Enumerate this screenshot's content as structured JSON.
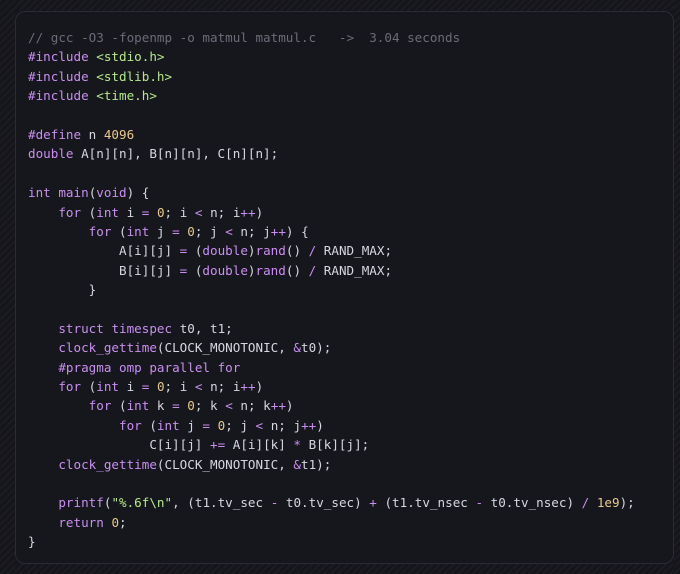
{
  "colors": {
    "background": "#15151b",
    "panel": "#16161d",
    "text": "#d7d7e0",
    "comment": "#6c6c78",
    "keyword": "#c98ff0",
    "string": "#b6e88a",
    "number": "#e8c98a"
  },
  "code": {
    "language": "c",
    "lines": [
      [
        {
          "t": "comment",
          "v": "// gcc -O3 -fopenmp -o matmul matmul.c   ->  3.04 seconds"
        }
      ],
      [
        {
          "t": "keyword",
          "v": "#include"
        },
        {
          "t": "plain",
          "v": " "
        },
        {
          "t": "string",
          "v": "<stdio.h>"
        }
      ],
      [
        {
          "t": "keyword",
          "v": "#include"
        },
        {
          "t": "plain",
          "v": " "
        },
        {
          "t": "string",
          "v": "<stdlib.h>"
        }
      ],
      [
        {
          "t": "keyword",
          "v": "#include"
        },
        {
          "t": "plain",
          "v": " "
        },
        {
          "t": "string",
          "v": "<time.h>"
        }
      ],
      [],
      [
        {
          "t": "keyword",
          "v": "#define"
        },
        {
          "t": "plain",
          "v": " n "
        },
        {
          "t": "number",
          "v": "4096"
        }
      ],
      [
        {
          "t": "keyword",
          "v": "double"
        },
        {
          "t": "plain",
          "v": " A[n][n], B[n][n], C[n][n];"
        }
      ],
      [],
      [
        {
          "t": "keyword",
          "v": "int"
        },
        {
          "t": "plain",
          "v": " "
        },
        {
          "t": "function",
          "v": "main"
        },
        {
          "t": "plain",
          "v": "("
        },
        {
          "t": "keyword",
          "v": "void"
        },
        {
          "t": "plain",
          "v": ") {"
        }
      ],
      [
        {
          "t": "plain",
          "v": "    "
        },
        {
          "t": "keyword",
          "v": "for"
        },
        {
          "t": "plain",
          "v": " ("
        },
        {
          "t": "keyword",
          "v": "int"
        },
        {
          "t": "plain",
          "v": " i "
        },
        {
          "t": "op",
          "v": "="
        },
        {
          "t": "plain",
          "v": " "
        },
        {
          "t": "number",
          "v": "0"
        },
        {
          "t": "plain",
          "v": "; i "
        },
        {
          "t": "op",
          "v": "<"
        },
        {
          "t": "plain",
          "v": " n; i"
        },
        {
          "t": "op",
          "v": "++"
        },
        {
          "t": "plain",
          "v": ")"
        }
      ],
      [
        {
          "t": "plain",
          "v": "        "
        },
        {
          "t": "keyword",
          "v": "for"
        },
        {
          "t": "plain",
          "v": " ("
        },
        {
          "t": "keyword",
          "v": "int"
        },
        {
          "t": "plain",
          "v": " j "
        },
        {
          "t": "op",
          "v": "="
        },
        {
          "t": "plain",
          "v": " "
        },
        {
          "t": "number",
          "v": "0"
        },
        {
          "t": "plain",
          "v": "; j "
        },
        {
          "t": "op",
          "v": "<"
        },
        {
          "t": "plain",
          "v": " n; j"
        },
        {
          "t": "op",
          "v": "++"
        },
        {
          "t": "plain",
          "v": ") {"
        }
      ],
      [
        {
          "t": "plain",
          "v": "            A[i][j] "
        },
        {
          "t": "op",
          "v": "="
        },
        {
          "t": "plain",
          "v": " ("
        },
        {
          "t": "keyword",
          "v": "double"
        },
        {
          "t": "plain",
          "v": ")"
        },
        {
          "t": "function",
          "v": "rand"
        },
        {
          "t": "plain",
          "v": "() "
        },
        {
          "t": "op",
          "v": "/"
        },
        {
          "t": "plain",
          "v": " RAND_MAX;"
        }
      ],
      [
        {
          "t": "plain",
          "v": "            B[i][j] "
        },
        {
          "t": "op",
          "v": "="
        },
        {
          "t": "plain",
          "v": " ("
        },
        {
          "t": "keyword",
          "v": "double"
        },
        {
          "t": "plain",
          "v": ")"
        },
        {
          "t": "function",
          "v": "rand"
        },
        {
          "t": "plain",
          "v": "() "
        },
        {
          "t": "op",
          "v": "/"
        },
        {
          "t": "plain",
          "v": " RAND_MAX;"
        }
      ],
      [
        {
          "t": "plain",
          "v": "        }"
        }
      ],
      [],
      [
        {
          "t": "plain",
          "v": "    "
        },
        {
          "t": "keyword",
          "v": "struct"
        },
        {
          "t": "plain",
          "v": " "
        },
        {
          "t": "keyword",
          "v": "timespec"
        },
        {
          "t": "plain",
          "v": " t0, t1;"
        }
      ],
      [
        {
          "t": "plain",
          "v": "    "
        },
        {
          "t": "function",
          "v": "clock_gettime"
        },
        {
          "t": "plain",
          "v": "(CLOCK_MONOTONIC, "
        },
        {
          "t": "op",
          "v": "&"
        },
        {
          "t": "plain",
          "v": "t0);"
        }
      ],
      [
        {
          "t": "plain",
          "v": "    "
        },
        {
          "t": "keyword",
          "v": "#pragma omp parallel for"
        }
      ],
      [
        {
          "t": "plain",
          "v": "    "
        },
        {
          "t": "keyword",
          "v": "for"
        },
        {
          "t": "plain",
          "v": " ("
        },
        {
          "t": "keyword",
          "v": "int"
        },
        {
          "t": "plain",
          "v": " i "
        },
        {
          "t": "op",
          "v": "="
        },
        {
          "t": "plain",
          "v": " "
        },
        {
          "t": "number",
          "v": "0"
        },
        {
          "t": "plain",
          "v": "; i "
        },
        {
          "t": "op",
          "v": "<"
        },
        {
          "t": "plain",
          "v": " n; i"
        },
        {
          "t": "op",
          "v": "++"
        },
        {
          "t": "plain",
          "v": ")"
        }
      ],
      [
        {
          "t": "plain",
          "v": "        "
        },
        {
          "t": "keyword",
          "v": "for"
        },
        {
          "t": "plain",
          "v": " ("
        },
        {
          "t": "keyword",
          "v": "int"
        },
        {
          "t": "plain",
          "v": " k "
        },
        {
          "t": "op",
          "v": "="
        },
        {
          "t": "plain",
          "v": " "
        },
        {
          "t": "number",
          "v": "0"
        },
        {
          "t": "plain",
          "v": "; k "
        },
        {
          "t": "op",
          "v": "<"
        },
        {
          "t": "plain",
          "v": " n; k"
        },
        {
          "t": "op",
          "v": "++"
        },
        {
          "t": "plain",
          "v": ")"
        }
      ],
      [
        {
          "t": "plain",
          "v": "            "
        },
        {
          "t": "keyword",
          "v": "for"
        },
        {
          "t": "plain",
          "v": " ("
        },
        {
          "t": "keyword",
          "v": "int"
        },
        {
          "t": "plain",
          "v": " j "
        },
        {
          "t": "op",
          "v": "="
        },
        {
          "t": "plain",
          "v": " "
        },
        {
          "t": "number",
          "v": "0"
        },
        {
          "t": "plain",
          "v": "; j "
        },
        {
          "t": "op",
          "v": "<"
        },
        {
          "t": "plain",
          "v": " n; j"
        },
        {
          "t": "op",
          "v": "++"
        },
        {
          "t": "plain",
          "v": ")"
        }
      ],
      [
        {
          "t": "plain",
          "v": "                C[i][j] "
        },
        {
          "t": "op",
          "v": "+="
        },
        {
          "t": "plain",
          "v": " A[i][k] "
        },
        {
          "t": "op",
          "v": "*"
        },
        {
          "t": "plain",
          "v": " B[k][j];"
        }
      ],
      [
        {
          "t": "plain",
          "v": "    "
        },
        {
          "t": "function",
          "v": "clock_gettime"
        },
        {
          "t": "plain",
          "v": "(CLOCK_MONOTONIC, "
        },
        {
          "t": "op",
          "v": "&"
        },
        {
          "t": "plain",
          "v": "t1);"
        }
      ],
      [],
      [
        {
          "t": "plain",
          "v": "    "
        },
        {
          "t": "function",
          "v": "printf"
        },
        {
          "t": "plain",
          "v": "("
        },
        {
          "t": "string",
          "v": "\"%.6f\\n\""
        },
        {
          "t": "plain",
          "v": ", (t1.tv_sec "
        },
        {
          "t": "op",
          "v": "-"
        },
        {
          "t": "plain",
          "v": " t0.tv_sec) "
        },
        {
          "t": "op",
          "v": "+"
        },
        {
          "t": "plain",
          "v": " (t1.tv_nsec "
        },
        {
          "t": "op",
          "v": "-"
        },
        {
          "t": "plain",
          "v": " t0.tv_nsec) "
        },
        {
          "t": "op",
          "v": "/"
        },
        {
          "t": "plain",
          "v": " "
        },
        {
          "t": "number",
          "v": "1e9"
        },
        {
          "t": "plain",
          "v": ");"
        }
      ],
      [
        {
          "t": "plain",
          "v": "    "
        },
        {
          "t": "keyword",
          "v": "return"
        },
        {
          "t": "plain",
          "v": " "
        },
        {
          "t": "number",
          "v": "0"
        },
        {
          "t": "plain",
          "v": ";"
        }
      ],
      [
        {
          "t": "plain",
          "v": "}"
        }
      ]
    ]
  }
}
